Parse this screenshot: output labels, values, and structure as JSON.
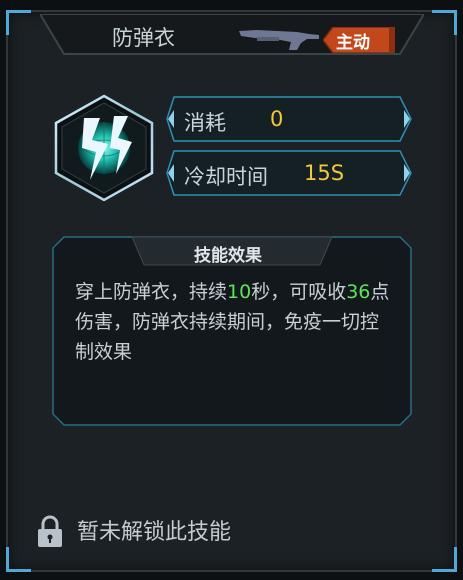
{
  "skill": {
    "name": "防弹衣",
    "type_badge": "主动",
    "icon": "shield-lightning-icon",
    "weapon_icon": "shotgun-icon"
  },
  "stats": {
    "cost_label": "消耗",
    "cost_value": "0",
    "cooldown_label": "冷却时间",
    "cooldown_value": "15S"
  },
  "effect": {
    "header": "技能效果",
    "desc_part1": "穿上防弹衣，持续",
    "duration": "10",
    "desc_part2": "秒，可吸收",
    "absorb": "36",
    "desc_part3": "点伤害，防弹衣持续期间，免疫一切控制效果"
  },
  "lock": {
    "icon": "lock-icon",
    "text": "暂未解锁此技能"
  },
  "colors": {
    "accent_blue": "#4fa8d8",
    "value_yellow": "#f2c93b",
    "highlight_green": "#5fe35a",
    "badge_orange": "#c2481c"
  }
}
